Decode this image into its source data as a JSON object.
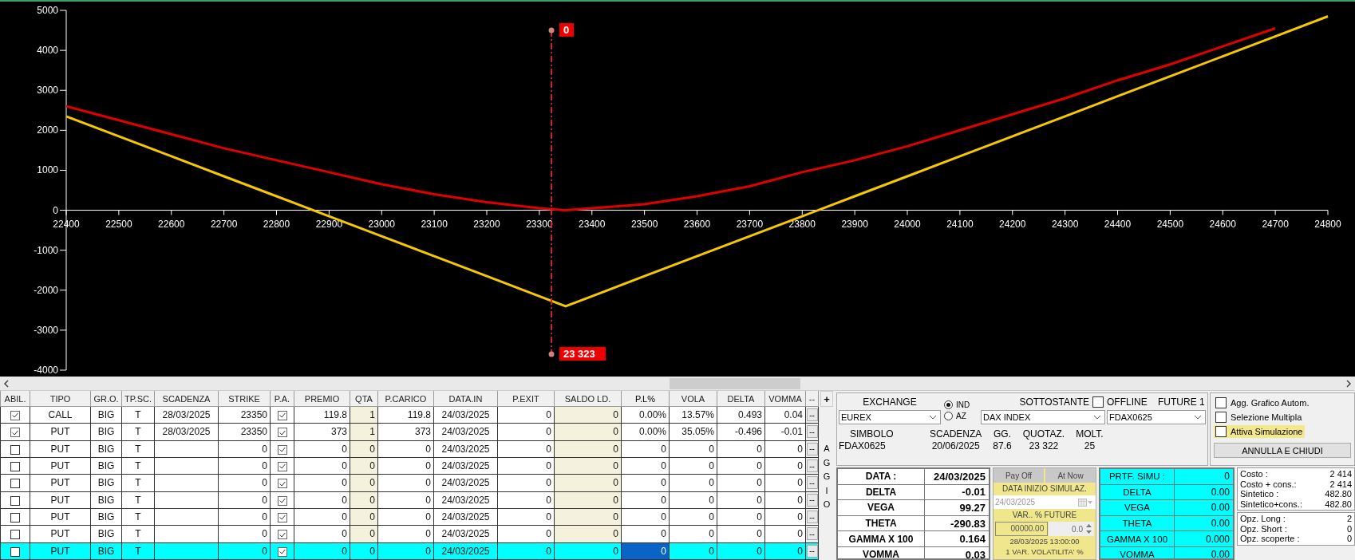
{
  "chart": {
    "chart_data": {
      "type": "line",
      "x": [
        22400,
        22500,
        22600,
        22700,
        22800,
        22900,
        23000,
        23100,
        23200,
        23300,
        23350,
        23400,
        23500,
        23600,
        23700,
        23800,
        23900,
        24000,
        24100,
        24200,
        24300,
        24400,
        24500,
        24600,
        24700,
        24800
      ],
      "series": [
        {
          "color": "#e00000",
          "values": [
            2600,
            2250,
            1900,
            1550,
            1250,
            950,
            650,
            400,
            200,
            50,
            0,
            50,
            150,
            350,
            600,
            950,
            1250,
            1600,
            2000,
            2400,
            2800,
            3250,
            3650,
            4100,
            4550,
            null
          ]
        },
        {
          "color": "#f5c800",
          "values": [
            2350,
            1850,
            1350,
            850,
            350,
            -150,
            -650,
            -1150,
            -1650,
            -2150,
            -2400,
            -2150,
            -1650,
            -1150,
            -650,
            -150,
            350,
            850,
            1350,
            1850,
            2350,
            2850,
            3350,
            3850,
            4350,
            4850
          ]
        }
      ],
      "xlim": [
        22400,
        24800
      ],
      "ylim": [
        -4000,
        5000
      ],
      "xticks": [
        22400,
        22500,
        22600,
        22700,
        22800,
        22900,
        23000,
        23100,
        23200,
        23300,
        23400,
        23500,
        23600,
        23700,
        23800,
        23900,
        24000,
        24100,
        24200,
        24300,
        24400,
        24500,
        24600,
        24700,
        24800
      ],
      "yticks": [
        -4000,
        -3000,
        -2000,
        -1000,
        0,
        1000,
        2000,
        3000,
        4000,
        5000
      ],
      "ref_lines": [
        {
          "axis": "x",
          "value": 23323,
          "color": "#c02828"
        }
      ],
      "annotations": [
        {
          "x": 23323,
          "y": 4500,
          "text": "0"
        },
        {
          "x": 23323,
          "y": -3600,
          "text": "23 323"
        }
      ]
    }
  },
  "positions": {
    "columns": [
      {
        "label": "ABIL.",
        "kind": "check",
        "focused": false
      },
      {
        "label": "TIPO",
        "kind": "text",
        "focused": false
      },
      {
        "label": "GR.O.",
        "kind": "text",
        "focused": false
      },
      {
        "label": "TP.SC.",
        "kind": "text",
        "focused": false
      },
      {
        "label": "SCADENZA",
        "kind": "text",
        "focused": false
      },
      {
        "label": "STRIKE",
        "kind": "number",
        "focused": false
      },
      {
        "label": "P.A.",
        "kind": "check",
        "focused": false
      },
      {
        "label": "PREMIO",
        "kind": "number",
        "focused": false
      },
      {
        "label": "QTA",
        "kind": "editable",
        "focused": false
      },
      {
        "label": "P.CARICO",
        "kind": "number",
        "focused": false
      },
      {
        "label": "DATA.IN",
        "kind": "text",
        "focused": false
      },
      {
        "label": "P.EXIT",
        "kind": "number",
        "focused": false
      },
      {
        "label": "SALDO LD.",
        "kind": "editable",
        "focused": false
      },
      {
        "label": "P.L%",
        "kind": "number",
        "focused": true
      },
      {
        "label": "VOLA",
        "kind": "number",
        "focused": false
      },
      {
        "label": "DELTA",
        "kind": "number",
        "focused": false
      },
      {
        "label": "VOMMA",
        "kind": "number",
        "focused": false
      },
      {
        "label": "--",
        "kind": "action",
        "focused": false
      }
    ],
    "rows": [
      {
        "selected": false,
        "cells": [
          true,
          "CALL",
          "BIG",
          "T",
          "28/03/2025",
          "23350",
          true,
          "119.8",
          "1",
          "119.8",
          "24/03/2025",
          "0",
          "0",
          "0.00%",
          "13.57%",
          "0.493",
          "0.04",
          "--"
        ]
      },
      {
        "selected": false,
        "cells": [
          true,
          "PUT",
          "BIG",
          "T",
          "28/03/2025",
          "23350",
          true,
          "373",
          "1",
          "373",
          "24/03/2025",
          "0",
          "0",
          "0.00%",
          "35.05%",
          "-0.496",
          "-0.01",
          "--"
        ]
      },
      {
        "selected": false,
        "cells": [
          false,
          "PUT",
          "BIG",
          "T",
          null,
          "0",
          true,
          "0",
          "0",
          "0",
          "24/03/2025",
          "0",
          "0",
          "0",
          "0",
          "0",
          "0",
          "--"
        ]
      },
      {
        "selected": false,
        "cells": [
          false,
          "PUT",
          "BIG",
          "T",
          null,
          "0",
          true,
          "0",
          "0",
          "0",
          "24/03/2025",
          "0",
          "0",
          "0",
          "0",
          "0",
          "0",
          "--"
        ]
      },
      {
        "selected": false,
        "cells": [
          false,
          "PUT",
          "BIG",
          "T",
          null,
          "0",
          true,
          "0",
          "0",
          "0",
          "24/03/2025",
          "0",
          "0",
          "0",
          "0",
          "0",
          "0",
          "--"
        ]
      },
      {
        "selected": false,
        "cells": [
          false,
          "PUT",
          "BIG",
          "T",
          null,
          "0",
          true,
          "0",
          "0",
          "0",
          "24/03/2025",
          "0",
          "0",
          "0",
          "0",
          "0",
          "0",
          "--"
        ]
      },
      {
        "selected": false,
        "cells": [
          false,
          "PUT",
          "BIG",
          "T",
          null,
          "0",
          true,
          "0",
          "0",
          "0",
          "24/03/2025",
          "0",
          "0",
          "0",
          "0",
          "0",
          "0",
          "--"
        ]
      },
      {
        "selected": false,
        "cells": [
          false,
          "PUT",
          "BIG",
          "T",
          null,
          "0",
          true,
          "0",
          "0",
          "0",
          "24/03/2025",
          "0",
          "0",
          "0",
          "0",
          "0",
          "0",
          "--"
        ]
      },
      {
        "selected": true,
        "cells": [
          false,
          "PUT",
          "BIG",
          "T",
          null,
          "0",
          true,
          "0",
          "0",
          "0",
          "24/03/2025",
          "0",
          "0",
          "0",
          "0",
          "0",
          "0",
          "--"
        ]
      }
    ],
    "add_button": "+",
    "side_label": "AGGIO"
  },
  "market": {
    "exchange_label": "EXCHANGE",
    "exchange": "EUREX",
    "modes": [
      {
        "label": "IND",
        "selected": true
      },
      {
        "label": "AZ",
        "selected": false
      }
    ],
    "underlying_label": "SOTTOSTANTE",
    "underlying": "DAX INDEX",
    "offline": {
      "label": "OFFLINE",
      "checked": false
    },
    "future_label": "FUTURE 1",
    "future": "FDAX0625",
    "info": [
      {
        "label": "SIMBOLO",
        "value": "FDAX0625"
      },
      {
        "label": "SCADENZA",
        "value": "20/06/2025"
      },
      {
        "label": "GG.",
        "value": "87.6"
      },
      {
        "label": "QUOTAZ.",
        "value": "23 322"
      },
      {
        "label": "MOLT.",
        "value": "25"
      }
    ]
  },
  "options": {
    "checkboxes": [
      {
        "label": "Agg. Grafico Autom.",
        "checked": false,
        "highlighted": false
      },
      {
        "label": "Selezione Multipla",
        "checked": false,
        "highlighted": false
      },
      {
        "label": "Attiva Simulazione",
        "checked": false,
        "highlighted": true
      }
    ],
    "close_button": "ANNULLA E CHIUDI"
  },
  "greeks": [
    {
      "label": "DATA :",
      "value": "24/03/2025"
    },
    {
      "label": "DELTA",
      "value": "-0.01"
    },
    {
      "label": "VEGA",
      "value": "99.27"
    },
    {
      "label": "THETA",
      "value": "-290.83"
    },
    {
      "label": "GAMMA X 100",
      "value": "0.164"
    },
    {
      "label": "VOMMA",
      "value": "0.03"
    }
  ],
  "simulation": {
    "buttons": [
      "Pay Off",
      "At Now"
    ],
    "start_label": "DATA INIZIO SIMULAZ.",
    "start_date": {
      "value": "24/03/2025",
      "disabled": true
    },
    "var_label": "VAR.. % FUTURE",
    "var_value": "00000.00",
    "spin_value": "0.0",
    "timestamp": "28/03/2025 13:00:00",
    "vol_label": "1 VAR. VOLATILITA' %"
  },
  "simulated": [
    {
      "label": "PRTF. SIMU :",
      "value": "0"
    },
    {
      "label": "DELTA",
      "value": "0.00"
    },
    {
      "label": "VEGA",
      "value": "0.00"
    },
    {
      "label": "THETA",
      "value": "0.00"
    },
    {
      "label": "GAMMA X 100",
      "value": "0.000"
    },
    {
      "label": "VOMMA",
      "value": "0.00"
    }
  ],
  "costs": [
    {
      "label": "Costo :",
      "value": "2 414"
    },
    {
      "label": "Costo + cons.:",
      "value": "2 414"
    },
    {
      "label": "Sintetico :",
      "value": "482.80"
    },
    {
      "label": "Sintetico+cons.:",
      "value": "482.80"
    }
  ],
  "counts": [
    {
      "label": "Opz. Long :",
      "value": "2"
    },
    {
      "label": "Opz. Short :",
      "value": "0"
    },
    {
      "label": "Opz. scoperte :",
      "value": "0"
    }
  ]
}
